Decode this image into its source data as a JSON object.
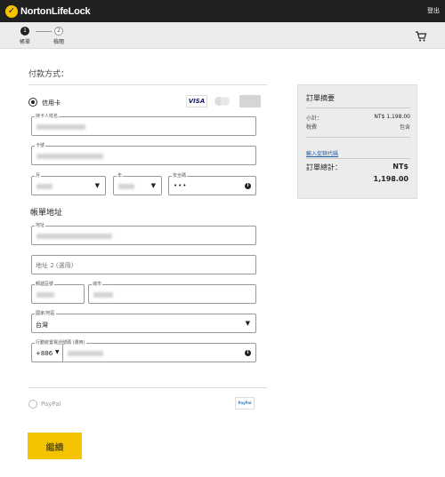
{
  "header": {
    "brand": "NortonLifeLock",
    "login_label": "登出"
  },
  "steps": [
    {
      "num": "1",
      "label": "帳單"
    },
    {
      "num": "2",
      "label": "檢閱"
    }
  ],
  "payment": {
    "title": "付款方式：",
    "credit_card_label": "信用卡",
    "card_logos": [
      "VISA",
      "Mastercard",
      "American Express"
    ],
    "cardholder_label": "持卡人姓名",
    "card_number_label": "卡號",
    "month_label": "月",
    "year_label": "年",
    "cvv_label": "安全碼",
    "cvv_value": "•••",
    "paypal_label": "PayPal",
    "paypal_badge": "PayPal"
  },
  "billing": {
    "title": "帳單地址",
    "address_label": "地址",
    "address2_placeholder": "地址 2 (選用)",
    "postal_label": "郵遞區號",
    "city_label": "城市",
    "country_label": "國家/地區",
    "country_value": "台灣",
    "phone_label": "行動裝置電話號碼 (選用)",
    "phone_code": "+886"
  },
  "summary": {
    "title": "訂單摘要",
    "subtotal_label": "小計：",
    "subtotal_value": "NT$ 1,198.00",
    "tax_label": "稅費",
    "tax_value": "包含",
    "promo_link": "輸入促銷代碼",
    "total_label": "訂單總計：",
    "total_currency": "NT$",
    "total_value": "1,198.00"
  },
  "continue_label": "繼續",
  "colors": {
    "topbar": "#202020",
    "accent": "#f5c400",
    "link": "#1f5fa8"
  },
  "icons": [
    "norton-check-logo",
    "cart-icon",
    "info-icon",
    "dropdown-caret-icon"
  ]
}
